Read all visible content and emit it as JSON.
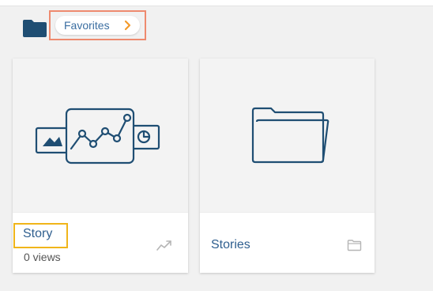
{
  "breadcrumb": {
    "items": [
      {
        "label": "Favorites"
      }
    ],
    "home_icon": "folder-icon",
    "separator_icon": "chevron-right-icon"
  },
  "cards": {
    "story": {
      "title": "Story",
      "meta": "0 views",
      "thumbnail_icon": "story-chart-icon",
      "type_icon": "trend-line-icon"
    },
    "stories": {
      "title": "Stories",
      "thumbnail_icon": "folder-icon",
      "type_icon": "folder-icon"
    }
  },
  "colors": {
    "background": "#f1f1f1",
    "brand_dark": "#1f4e73",
    "link_text": "#3b6ea1",
    "breadcrumb_highlight": "#ee8a6f",
    "chevron": "#f39a2b",
    "title_highlight": "#f0b51a"
  }
}
